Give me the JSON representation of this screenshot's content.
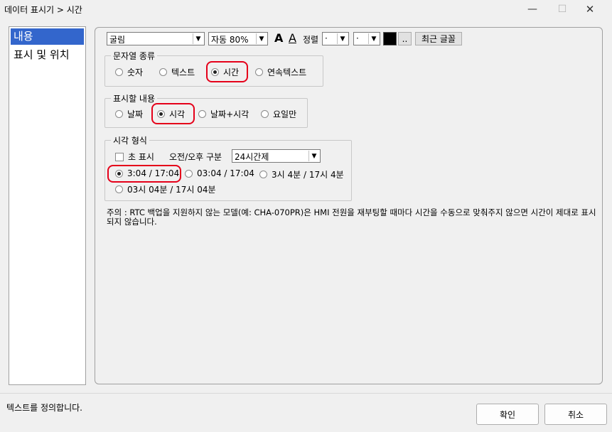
{
  "window": {
    "title": "데이터 표시기 > 시간",
    "minimize_icon": "minimize-icon",
    "maximize_icon": "maximize-icon",
    "close_icon": "close-icon"
  },
  "nav": {
    "items": [
      {
        "label": "내용",
        "selected": true
      },
      {
        "label": "표시 및 위치",
        "selected": false
      }
    ]
  },
  "toolbar": {
    "font_value": "굴림",
    "size_value": "자동 80%",
    "font_grow_label": "A",
    "font_shrink_label": "A",
    "align_label": "정렬",
    "align_h_value": "·",
    "align_v_value": "·",
    "color_value": "#000000",
    "color_more_label": "..",
    "recent_fonts_label": "최근 글꼴"
  },
  "string_type": {
    "legend": "문자열 종류",
    "options": [
      {
        "label": "숫자",
        "selected": false
      },
      {
        "label": "텍스트",
        "selected": false
      },
      {
        "label": "시간",
        "selected": true
      },
      {
        "label": "연속텍스트",
        "selected": false
      }
    ]
  },
  "display_content": {
    "legend": "표시할 내용",
    "options": [
      {
        "label": "날짜",
        "selected": false
      },
      {
        "label": "시각",
        "selected": true
      },
      {
        "label": "날짜+시각",
        "selected": false
      },
      {
        "label": "요일만",
        "selected": false
      }
    ]
  },
  "time_format": {
    "legend": "시각 형식",
    "show_seconds_label": "초 표시",
    "show_seconds_checked": false,
    "ampm_label": "오전/오후 구분",
    "ampm_value": "24시간제",
    "options": [
      {
        "label": "3:04 / 17:04",
        "selected": true
      },
      {
        "label": "03:04 / 17:04",
        "selected": false
      },
      {
        "label": "3시 4분 / 17시 4분",
        "selected": false
      },
      {
        "label": "03시 04분 / 17시 04분",
        "selected": false
      }
    ]
  },
  "note": "주의 : RTC 백업을 지원하지 않는 모델(예: CHA-070PR)은 HMI 전원을 재부팅할 때마다 시간을 수동으로 맞춰주지 않으면 시간이 제대로 표시되지 않습니다.",
  "status_text": "텍스트를 정의합니다.",
  "buttons": {
    "ok_label": "확인",
    "cancel_label": "취소"
  },
  "colors": {
    "selection": "#3366cc",
    "highlight": "#e5001a"
  }
}
